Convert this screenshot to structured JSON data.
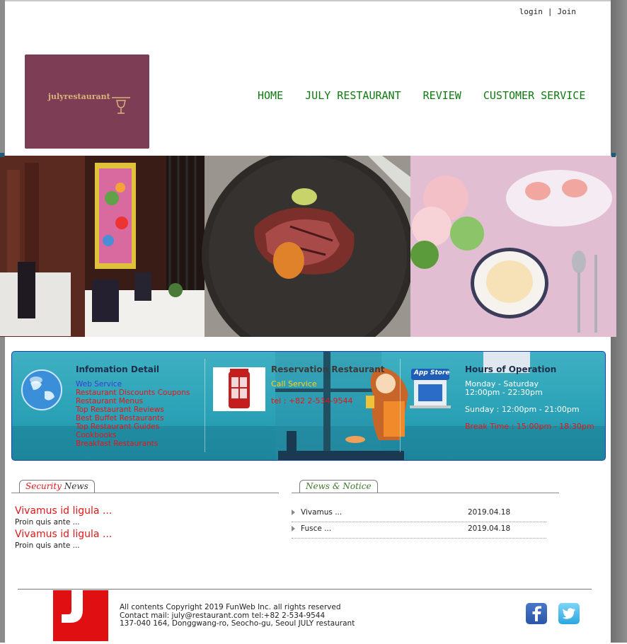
{
  "header": {
    "login": "login",
    "separator": "|",
    "join": "Join",
    "logo_text": "julyrestaurant"
  },
  "nav": [
    "HOME",
    "JULY RESTAURANT",
    "REVIEW",
    "CUSTOMER SERVICE"
  ],
  "info": {
    "detail": {
      "title": "Infomation Detail",
      "items": [
        "Web Service",
        "Restaurant Discounts Coupons",
        "Restaurant Menus",
        "Top Restaurant Reviews",
        "Best Buffet Restaurants",
        "Top Restaurant Guides",
        "Cookbooks",
        "Breakfast Restaurants"
      ]
    },
    "reservation": {
      "title": "Reservation Restaurant",
      "call": "Call Service",
      "tel": "tel : +82 2-534-9544"
    },
    "hours": {
      "title": "Hours of Operation",
      "weekday": "Monday - Saturday",
      "weekday_time": "12:00pm - 22:30pm",
      "sunday": "Sunday : 12:00pm - 21:00pm",
      "break": "Break Time : 15:00pm - 18:30pm",
      "appstore": "App Store"
    }
  },
  "security_news": {
    "tab_accent": "Security",
    "tab_rest": " News",
    "items": [
      {
        "title": "Vivamus id ligula ...",
        "sub": "Proin quis ante ..."
      },
      {
        "title": "Vivamus id ligula ...",
        "sub": "Proin quis ante ..."
      }
    ]
  },
  "notice": {
    "tab": "News & Notice",
    "items": [
      {
        "title": "Vivamus ...",
        "date": "2019.04.18"
      },
      {
        "title": "Fusce ...",
        "date": "2019.04.18"
      }
    ]
  },
  "footer": {
    "line1": "All contents Copyright 2019 FunWeb Inc. all rights reserved",
    "line2": "Contact mail: july@restaurant.com tel:+82 2-534-9544",
    "line3": "137-040 164, Donggwang-ro, Seocho-gu, Seoul JULY restaurant"
  },
  "icons": {
    "facebook": "facebook-icon",
    "twitter": "twitter-icon",
    "globe": "globe-icon",
    "phone_booth": "phone-booth-icon",
    "app_store": "app-store-icon"
  },
  "colors": {
    "nav": "#0f7a0f",
    "logo_bg": "#7d3d55",
    "info_bg": "#2aa1b6",
    "accent_red": "#e01818",
    "call_yellow": "#ffd21a",
    "footer_logo": "#e00f12"
  }
}
